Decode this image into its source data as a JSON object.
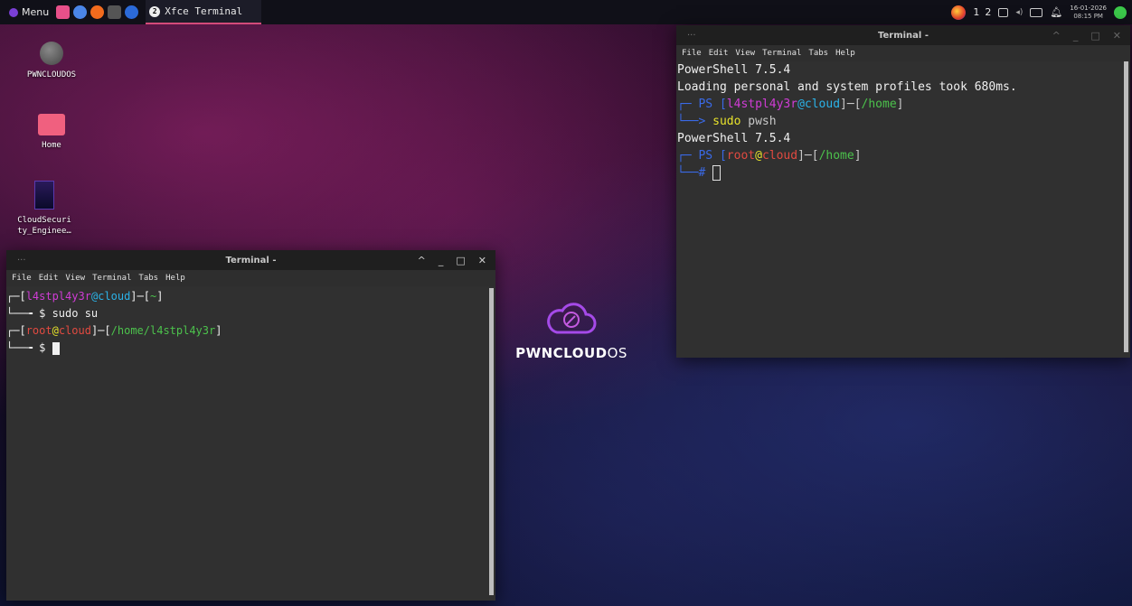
{
  "panel": {
    "menu_label": "Menu",
    "task_badge": "2",
    "task_title": "Xfce Terminal",
    "workspaces": [
      "1",
      "2"
    ],
    "clock_date": "16-01-2026",
    "clock_time": "08:15 PM"
  },
  "desktop": {
    "icons": [
      {
        "label": "PWNCLOUDOS"
      },
      {
        "label": "Home"
      },
      {
        "label": "CloudSecuri ty_Enginee…"
      }
    ],
    "brand_a": "PWNCLOUD",
    "brand_b": "OS"
  },
  "term_left": {
    "title": "Terminal -",
    "dots": "···",
    "menu": [
      "File",
      "Edit",
      "View",
      "Terminal",
      "Tabs",
      "Help"
    ],
    "l1": {
      "p1": "┌─[",
      "user": "l4stpl4y3r",
      "at": "@",
      "host": "cloud",
      "p2": "]─[",
      "dir": "~",
      "p3": "]"
    },
    "l2": {
      "p": "└──╼ ",
      "cmd": "$ sudo su"
    },
    "l3": {
      "p1": "┌─[",
      "user": "root",
      "at": "@",
      "host": "cloud",
      "p2": "]─[",
      "dir": "/home/l4stpl4y3r",
      "p3": "]"
    },
    "l4": {
      "p": "└──╼ ",
      "cmd": "$ "
    }
  },
  "term_right": {
    "title": "Terminal -",
    "dots": "···",
    "menu": [
      "File",
      "Edit",
      "View",
      "Terminal",
      "Tabs",
      "Help"
    ],
    "l1": "PowerShell 7.5.4",
    "l2": "Loading personal and system profiles took 680ms.",
    "l3": {
      "p": "┌─ PS [",
      "user": "l4stpl4y3r",
      "at": "@",
      "host": "cloud",
      "p2": "]─[",
      "dir": "/home",
      "p3": "]"
    },
    "l4": {
      "p": "└──> ",
      "cmd1": "sudo",
      "cmd2": " pwsh"
    },
    "l5": "PowerShell 7.5.4",
    "l6": {
      "p": "┌─ PS [",
      "user": "root",
      "at": "@",
      "host": "cloud",
      "p2": "]─[",
      "dir": "/home",
      "p3": "]"
    },
    "l7": {
      "p": "└──# "
    }
  }
}
